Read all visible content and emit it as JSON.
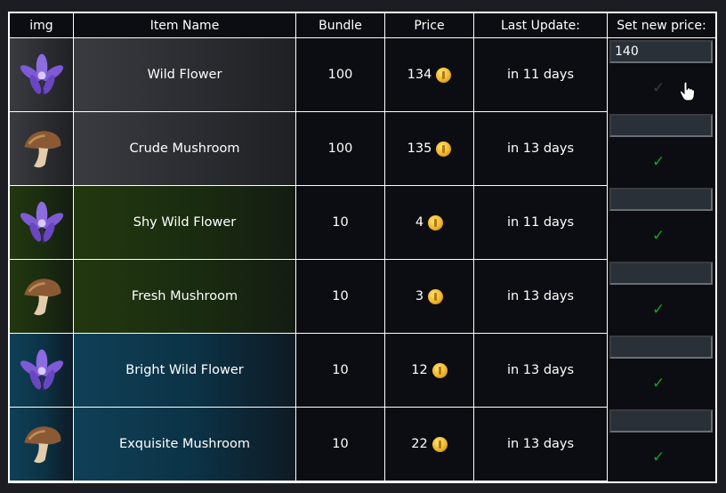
{
  "headers": {
    "img": "img",
    "name": "Item Name",
    "bundle": "Bundle",
    "price": "Price",
    "update": "Last Update:",
    "set_price": "Set new price:"
  },
  "rows": [
    {
      "name": "Wild Flower",
      "bundle": "100",
      "price": "134",
      "update": "in 11 days",
      "icon": "purple-flower-icon",
      "tier": "common",
      "new_price": "140",
      "confirm": "✓",
      "confirm_enabled": false
    },
    {
      "name": "Crude Mushroom",
      "bundle": "100",
      "price": "135",
      "update": "in 13 days",
      "icon": "brown-mushroom-icon",
      "tier": "common",
      "new_price": "",
      "confirm": "✓",
      "confirm_enabled": true
    },
    {
      "name": "Shy Wild Flower",
      "bundle": "10",
      "price": "4",
      "update": "in 11 days",
      "icon": "purple-flower-icon",
      "tier": "uncommon",
      "new_price": "",
      "confirm": "✓",
      "confirm_enabled": true
    },
    {
      "name": "Fresh Mushroom",
      "bundle": "10",
      "price": "3",
      "update": "in 13 days",
      "icon": "brown-mushroom-icon",
      "tier": "uncommon",
      "new_price": "",
      "confirm": "✓",
      "confirm_enabled": true
    },
    {
      "name": "Bright Wild Flower",
      "bundle": "10",
      "price": "12",
      "update": "in 13 days",
      "icon": "purple-flower-icon",
      "tier": "rare",
      "new_price": "",
      "confirm": "✓",
      "confirm_enabled": true
    },
    {
      "name": "Exquisite Mushroom",
      "bundle": "10",
      "price": "22",
      "update": "in 13 days",
      "icon": "brown-mushroom-icon",
      "tier": "rare",
      "new_price": "",
      "confirm": "✓",
      "confirm_enabled": true
    }
  ],
  "colors": {
    "common": "#2e2f34",
    "uncommon": "#1e3210",
    "rare": "#0d394e",
    "confirm": "#1ca01c",
    "coin": "#f0b62a"
  }
}
